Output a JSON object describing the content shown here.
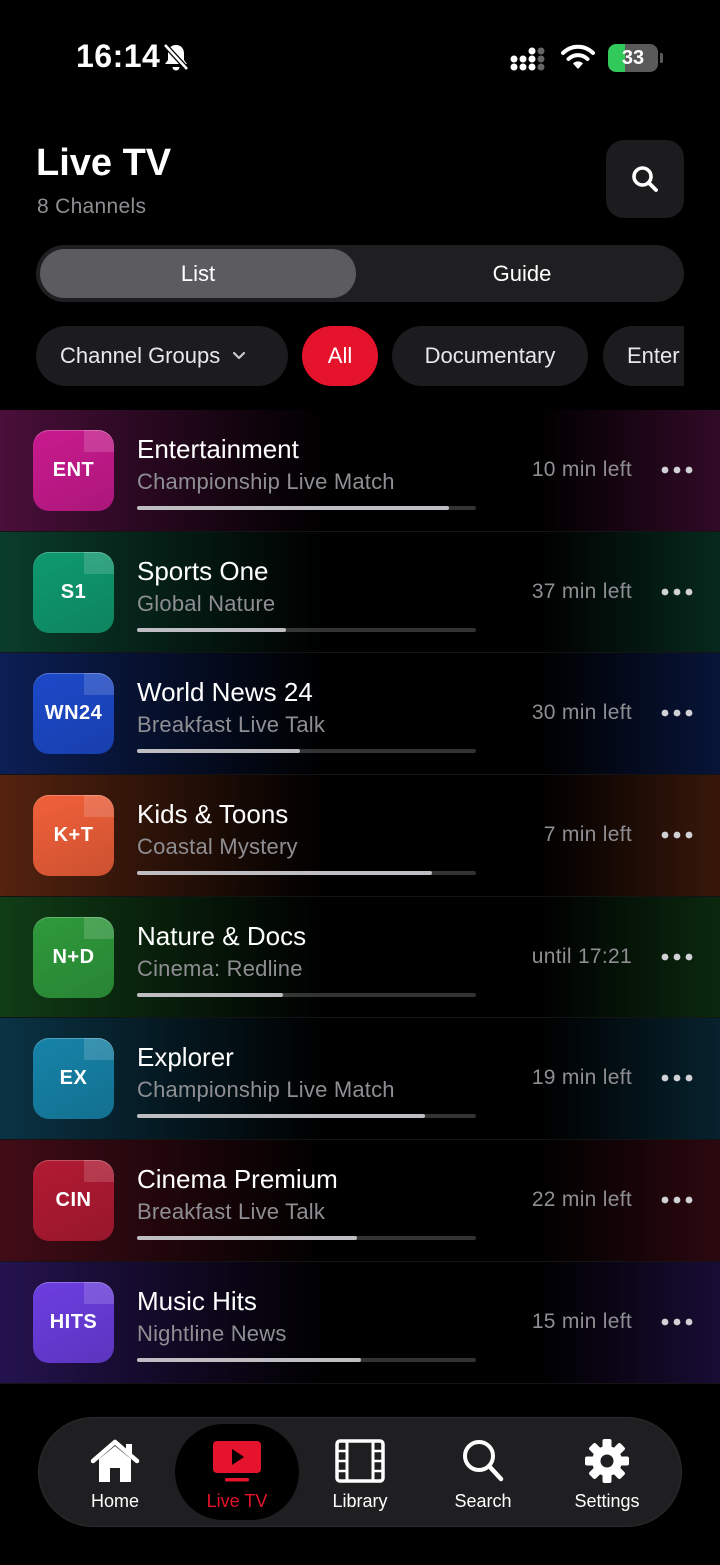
{
  "status_bar": {
    "time": "16:14",
    "battery": "33",
    "battery_level": 0.33
  },
  "header": {
    "title": "Live TV",
    "subtitle": "8 Channels"
  },
  "view_toggle": {
    "list": "List",
    "guide": "Guide"
  },
  "filters": {
    "groups": "Channel Groups",
    "all": "All",
    "documentary": "Documentary",
    "entertainment": "Enter"
  },
  "channels": [
    {
      "logo": "ENT",
      "name": "Entertainment",
      "program": "Championship Live Match",
      "time": "10 min left",
      "progress": 0.92,
      "color": "#c91a8e",
      "bg": "#4a0f3a"
    },
    {
      "logo": "S1",
      "name": "Sports One",
      "program": "Global Nature",
      "time": "37 min left",
      "progress": 0.44,
      "color": "#0f9a6e",
      "bg": "#0a3d2c"
    },
    {
      "logo": "WN24",
      "name": "World News 24",
      "program": "Breakfast Live Talk",
      "time": "30 min left",
      "progress": 0.48,
      "color": "#1c49c9",
      "bg": "#0c1f55"
    },
    {
      "logo": "K+T",
      "name": "Kids & Toons",
      "program": "Coastal Mystery",
      "time": "7 min left",
      "progress": 0.87,
      "color": "#f0603a",
      "bg": "#55230f"
    },
    {
      "logo": "N+D",
      "name": "Nature & Docs",
      "program": "Cinema: Redline",
      "time": "until 17:21",
      "progress": 0.43,
      "color": "#2f9a3c",
      "bg": "#103d16"
    },
    {
      "logo": "EX",
      "name": "Explorer",
      "program": "Championship Live Match",
      "time": "19 min left",
      "progress": 0.85,
      "color": "#1683a8",
      "bg": "#0a3344"
    },
    {
      "logo": "CIN",
      "name": "Cinema Premium",
      "program": "Breakfast Live Talk",
      "time": "22 min left",
      "progress": 0.65,
      "color": "#b11a32",
      "bg": "#420c17"
    },
    {
      "logo": "HITS",
      "name": "Music Hits",
      "program": "Nightline News",
      "time": "15 min left",
      "progress": 0.66,
      "color": "#6c3ee0",
      "bg": "#25134f"
    }
  ],
  "tabs": [
    {
      "label": "Home",
      "icon": "home-icon"
    },
    {
      "label": "Live TV",
      "icon": "live-tv-icon"
    },
    {
      "label": "Library",
      "icon": "library-icon"
    },
    {
      "label": "Search",
      "icon": "search-icon"
    },
    {
      "label": "Settings",
      "icon": "settings-icon"
    }
  ],
  "accent": "#e5132b"
}
